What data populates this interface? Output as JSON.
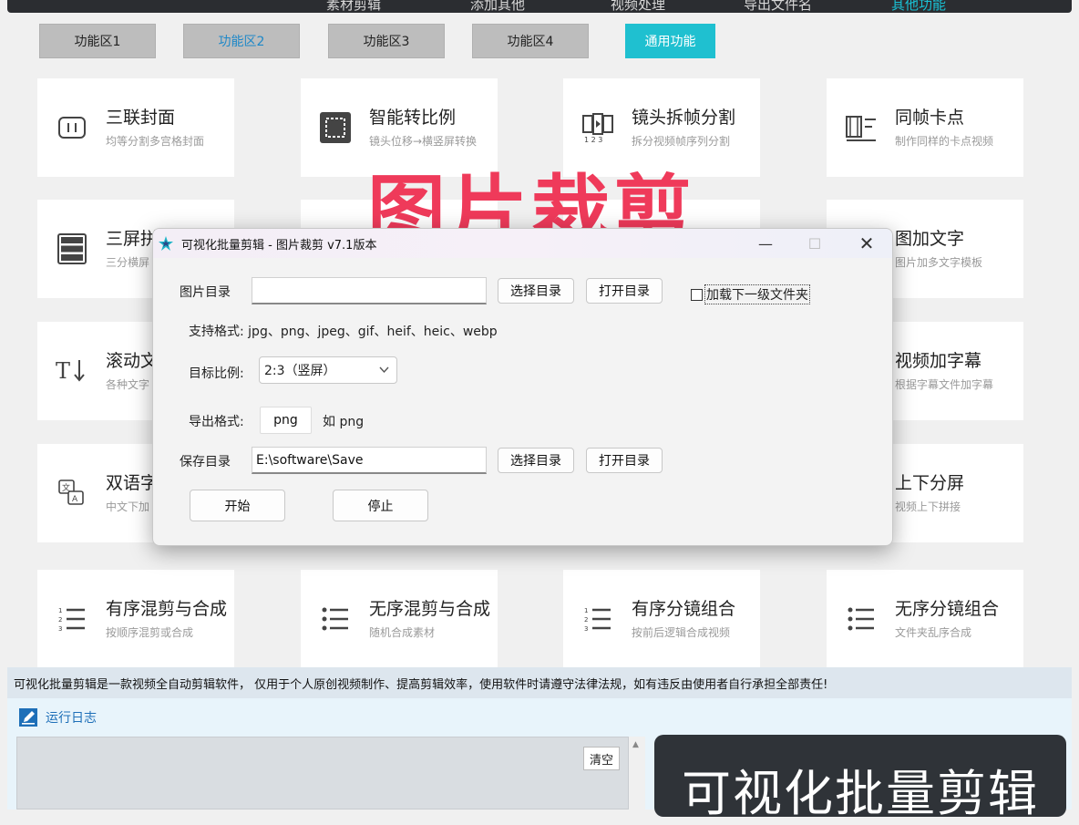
{
  "top_menu": [
    {
      "label": "素材剪辑",
      "active": false
    },
    {
      "label": "添加其他",
      "active": false
    },
    {
      "label": "视频处理",
      "active": false
    },
    {
      "label": "导出文件名",
      "active": false
    },
    {
      "label": "其他功能",
      "active": true
    }
  ],
  "zones": [
    {
      "label": "功能区1"
    },
    {
      "label": "功能区2"
    },
    {
      "label": "功能区3"
    },
    {
      "label": "功能区4"
    },
    {
      "label": "通用功能"
    }
  ],
  "cards": [
    {
      "title": "三联封面",
      "sub": "均等分割多宫格封面",
      "icon": "split-rectangle-icon"
    },
    {
      "title": "智能转比例",
      "sub": "镜头位移→横竖屏转换",
      "icon": "crop-frame-icon"
    },
    {
      "title": "镜头拆帧分割",
      "sub": "拆分视频帧序列分割",
      "icon": "film-frames-icon"
    },
    {
      "title": "同帧卡点",
      "sub": "制作同样的卡点视频",
      "icon": "film-strip-list-icon"
    },
    {
      "title": "三屏拼",
      "sub": "三分横屏",
      "icon": "three-rows-icon"
    },
    {
      "title": "图加文字",
      "sub": "图片加多文字模板",
      "icon": ""
    },
    {
      "title": "滚动文",
      "sub": "各种文字",
      "icon": "text-scroll-icon"
    },
    {
      "title": "视频加字幕",
      "sub": "根据字幕文件加字幕",
      "icon": ""
    },
    {
      "title": "双语字",
      "sub": "中文下加",
      "icon": "translate-icon"
    },
    {
      "title": "上下分屏",
      "sub": "视频上下拼接",
      "icon": ""
    },
    {
      "title": "有序混剪与合成",
      "sub": "按顺序混剪或合成",
      "icon": "ordered-list-icon"
    },
    {
      "title": "无序混剪与合成",
      "sub": "随机合成素材",
      "icon": "bullet-list-icon"
    },
    {
      "title": "有序分镜组合",
      "sub": "按前后逻辑合成视频",
      "icon": "ordered-list-icon"
    },
    {
      "title": "无序分镜组合",
      "sub": "文件夹乱序合成",
      "icon": "bullet-list-icon"
    }
  ],
  "watermark": "图片裁剪",
  "dialog": {
    "title": "可视化批量剪辑 - 图片裁剪  v7.1版本",
    "image_dir_label": "图片目录",
    "image_dir_value": "",
    "choose_dir": "选择目录",
    "open_dir": "打开目录",
    "load_subfolder": "加载下一级文件夹",
    "formats": "支持格式:  jpg、png、jpeg、gif、heif、heic、webp",
    "ratio_label": "目标比例:",
    "ratio_value": "2:3（竖屏）",
    "export_label": "导出格式:",
    "export_value": "png",
    "export_hint": "如 png",
    "save_dir_label": "保存目录",
    "save_dir_value": "E:\\software\\Save",
    "start": "开始",
    "stop": "停止"
  },
  "notice": "可视化批量剪辑是一款视频全自动剪辑软件， 仅用于个人原创视频制作、提高剪辑效率，使用软件时请遵守法律法规，如有违反由使用者自行承担全部责任!",
  "log": {
    "title": "运行日志",
    "clear": "清空"
  },
  "brand": "可视化批量剪辑",
  "colors": {
    "accent": "#1fc0d0",
    "watermark": "#ef3a5a",
    "log_title": "#1e6fb8"
  }
}
